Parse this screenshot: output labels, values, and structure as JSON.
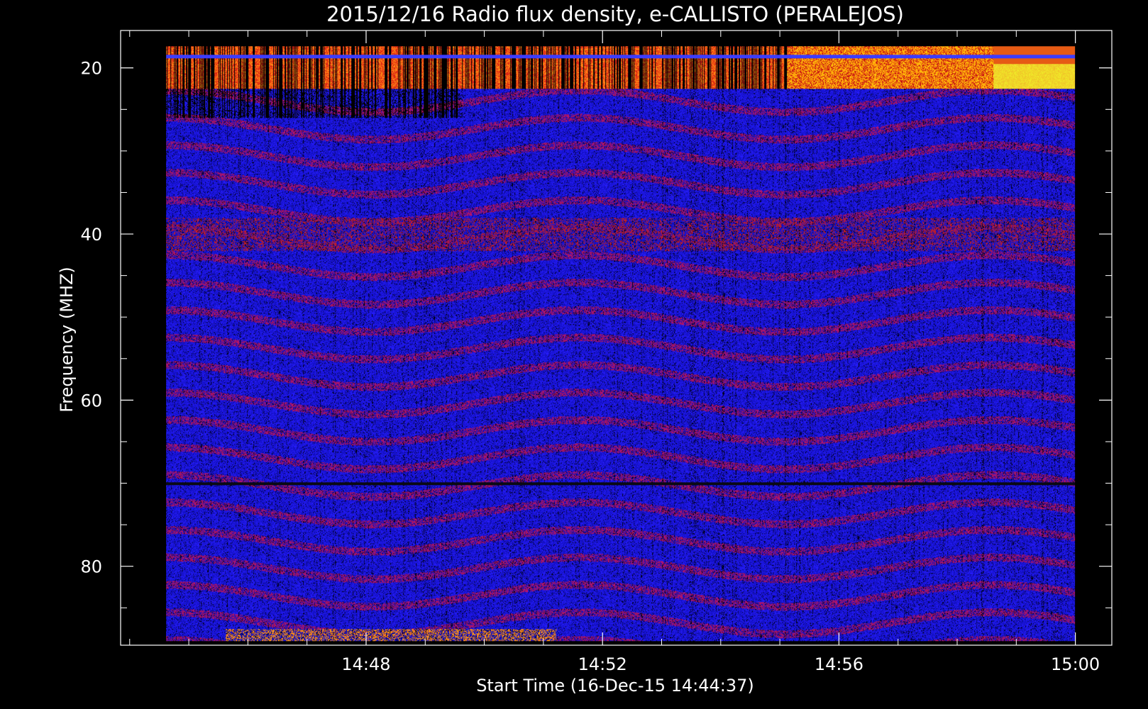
{
  "chart_data": {
    "type": "heatmap",
    "title": "2015/12/16  Radio flux density, e-CALLISTO (PERALEJOS)",
    "xlabel": "Start Time (16-Dec-15 14:44:37)",
    "ylabel": "Frequency (MHZ)",
    "x_tick_labels": [
      "14:48",
      "14:52",
      "14:56",
      "15:00"
    ],
    "x_tick_minutes": [
      3.3833,
      7.3833,
      11.3833,
      15.3833
    ],
    "x_range_minutes": [
      -0.77,
      16.0
    ],
    "data_time_range_minutes": [
      0.0,
      15.3833
    ],
    "y_tick_values": [
      20,
      40,
      60,
      80
    ],
    "y_range": [
      89.5,
      15.5
    ],
    "data_freq_range": [
      17.4,
      89.0
    ],
    "y_axis_inverted": true,
    "colormap": [
      "#000000",
      "#1010ff",
      "#c02020",
      "#ff6000",
      "#ffd040",
      "#ffffff"
    ],
    "features": [
      {
        "freq_range": [
          17.4,
          22.5
        ],
        "time_range_minutes": [
          0.0,
          15.3833
        ],
        "level": "high (red/orange/yellow), strongest after 14:58"
      },
      {
        "freq_range": [
          22.5,
          26.0
        ],
        "time_range_minutes": [
          0.0,
          5.0
        ],
        "level": "low (black)"
      },
      {
        "freq_range": [
          38.0,
          42.0
        ],
        "time_range_minutes": [
          0.0,
          15.3833
        ],
        "level": "moderate (red)"
      },
      {
        "freq_range": [
          69.8,
          70.2
        ],
        "time_range_minutes": [
          0.0,
          15.3833
        ],
        "level": "low (black line)"
      },
      {
        "freq_range": [
          87.5,
          89.0
        ],
        "time_range_minutes": [
          1.0,
          6.6
        ],
        "level": "moderate (red/orange)"
      }
    ],
    "grid": false,
    "legend": "none"
  }
}
